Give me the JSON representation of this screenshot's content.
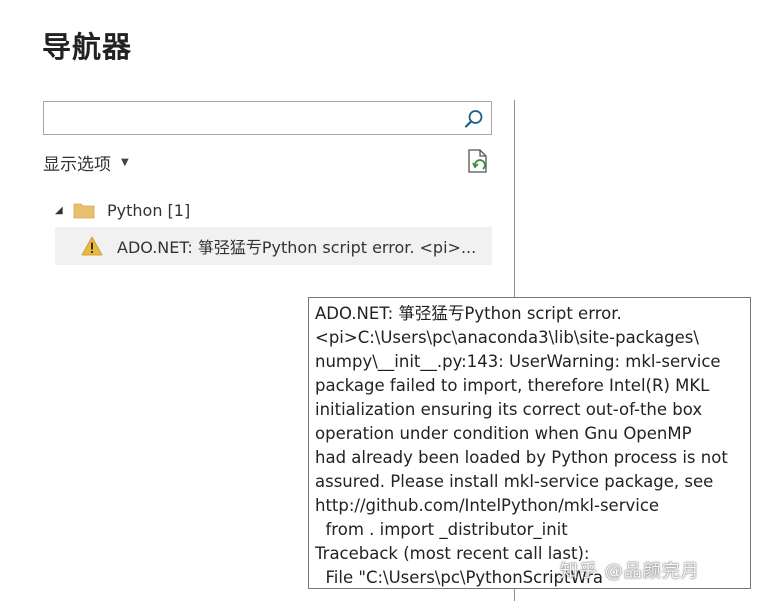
{
  "navigator": {
    "title": "导航器",
    "search": {
      "value": "",
      "placeholder": ""
    },
    "display_options_label": "显示选项",
    "tree": {
      "folder_label": "Python [1]",
      "items": [
        {
          "label": "ADO.NET: 箏弪猛亐Python script error. <pi>..."
        }
      ]
    }
  },
  "tooltip": {
    "text": "ADO.NET: 箏弪猛亐Python script error.\n<pi>C:\\Users\\pc\\anaconda3\\lib\\site-packages\\\nnumpy\\__init__.py:143: UserWarning: mkl-service\npackage failed to import, therefore Intel(R) MKL\ninitialization ensuring its correct out-of-the box\noperation under condition when Gnu OpenMP\nhad already been loaded by Python process is not\nassured. Please install mkl-service package, see\nhttp://github.com/IntelPython/mkl-service\n  from . import _distributor_init\nTraceback (most recent call last):\n  File \"C:\\Users\\pc\\PythonScriptWra"
  },
  "watermark": {
    "text": "知乎 @品颜完月"
  },
  "colors": {
    "folder": "#e8c170",
    "warning": "#e8b93b",
    "selected_row": "#f1f1f1",
    "refresh_accent": "#3a8f3a"
  },
  "icons": {
    "search": "search-icon",
    "refresh": "refresh-icon",
    "folder": "folder-icon",
    "warning": "warning-icon",
    "expander": "expand-triangle-icon",
    "dropdown": "caret-down-icon"
  }
}
